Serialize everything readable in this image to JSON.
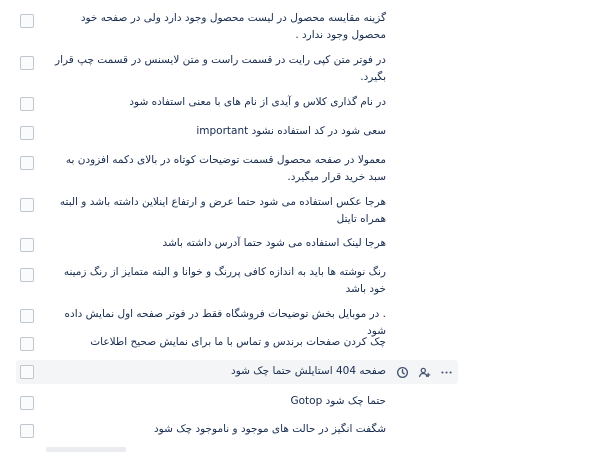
{
  "checklist": {
    "items": [
      {
        "text": "گزینه مقایسه محصول در لیست محصول وجود دارد ولی در صفحه خود محصول وجود ندارد .",
        "checked": false
      },
      {
        "text": "در فوتر متن کپی رایت در قسمت راست و متن لایسنس در قسمت چپ قرار بگیرد.",
        "checked": false
      },
      {
        "text": "در نام گذاری کلاس و آیدی از نام های با معنی استفاده شود",
        "checked": false
      },
      {
        "text": "سعی شود در کد استفاده نشود important",
        "checked": false
      },
      {
        "text": "معمولا در صفحه محصول قسمت توضیحات کوتاه در بالای دکمه افزودن به سبد خرید قرار میگیرد.",
        "checked": false
      },
      {
        "text": "هرجا عکس استفاده می شود حتما عرض و ارتفاع اینلاین داشته باشد و البته همراه تایتل",
        "checked": false
      },
      {
        "text": "هرجا لینک استفاده می شود حتما آدرس داشته باشد",
        "checked": false
      },
      {
        "text": "رنگ نوشته ها باید به اندازه کافی پررنگ و خوانا و البته متمایز از رنگ زمینه خود باشد",
        "checked": false
      },
      {
        "text": ". در موبایل بخش توضیحات فروشگاه فقط در فوتر صفحه اول نمایش داده شود",
        "checked": false
      },
      {
        "text": "چک کردن صفحات برندس و تماس با ما برای نمایش صحیح اطلاعات",
        "checked": false
      },
      {
        "text": "صفحه 404 استایلش حتما چک شود",
        "checked": false
      },
      {
        "text": "حتما چک شود Gotop",
        "checked": false
      },
      {
        "text": "شگفت انگیز در حالت های موجود و ناموجود چک شود",
        "checked": false
      }
    ]
  },
  "hover_tools": [
    "clock-icon",
    "assign-user-icon",
    "more-icon"
  ]
}
